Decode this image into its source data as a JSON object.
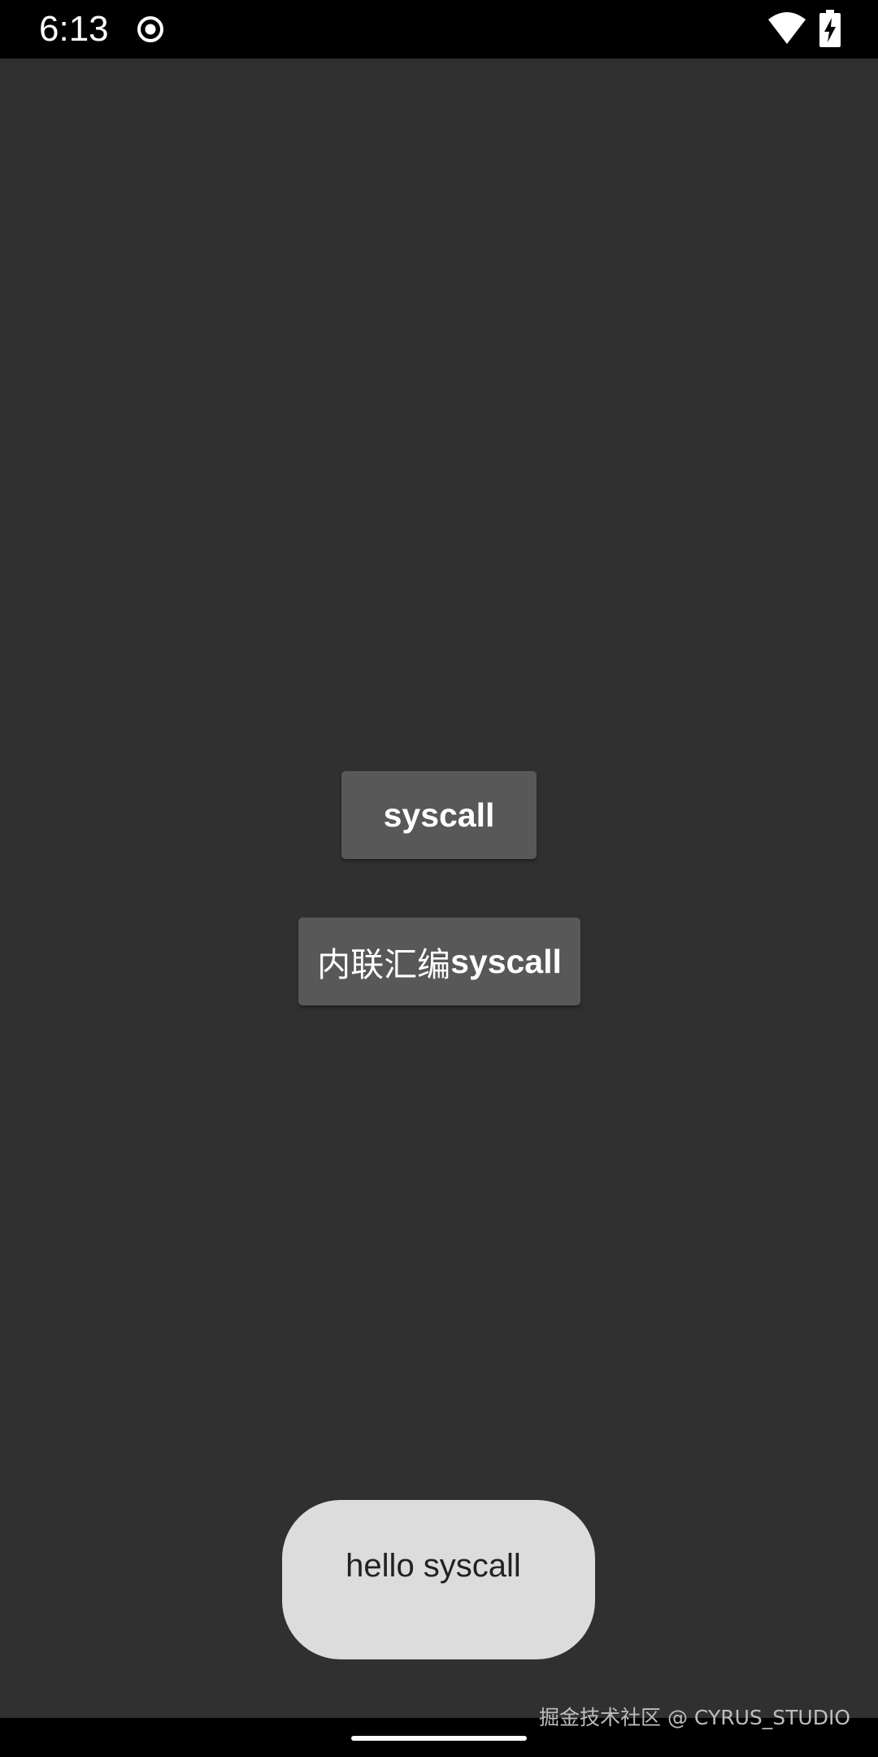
{
  "status_bar": {
    "time": "6:13",
    "icons": [
      "record-icon",
      "wifi-icon",
      "battery-charging-icon"
    ]
  },
  "main": {
    "syscall_button_label": "syscall",
    "inline_asm_button_label_cn": "内联汇编",
    "inline_asm_button_label_en": "syscall"
  },
  "toast": {
    "message": "hello syscall"
  },
  "watermark": {
    "text": "掘金技术社区 @ CYRUS_STUDIO"
  },
  "colors": {
    "background": "#303030",
    "button": "#585858",
    "toast": "#dcdcdc",
    "status_bar": "#000000"
  }
}
